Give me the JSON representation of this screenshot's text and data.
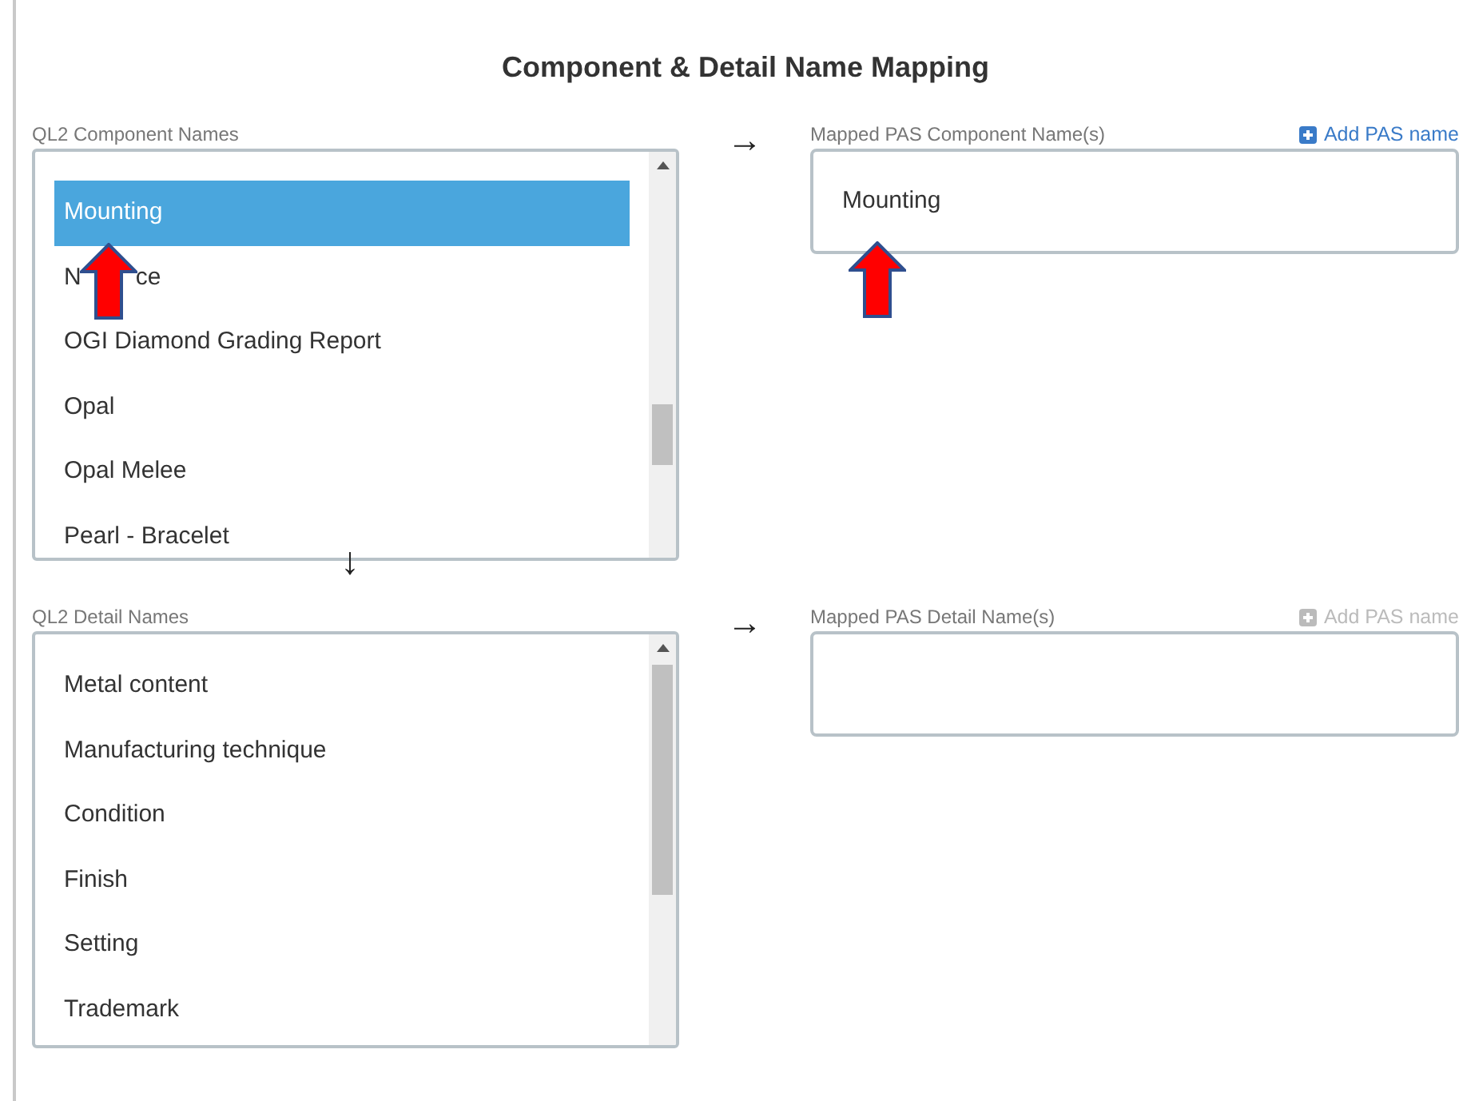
{
  "title": "Component & Detail Name Mapping",
  "sections": [
    {
      "source_label": "QL2 Component Names",
      "down_arrow": "↓",
      "right_arrow": "→",
      "mapped_label": "Mapped PAS Component Name(s)",
      "add_link": {
        "label": "Add PAS name",
        "disabled": false
      },
      "items": [
        {
          "label": "Mounting",
          "selected": true
        },
        {
          "label": "N",
          "label_end": "ce",
          "selected": false
        },
        {
          "label": "OGI Diamond Grading Report",
          "selected": false
        },
        {
          "label": "Opal",
          "selected": false
        },
        {
          "label": "Opal Melee",
          "selected": false
        },
        {
          "label": "Pearl - Bracelet",
          "selected": false
        }
      ],
      "mapped": [
        "Mounting"
      ]
    },
    {
      "source_label": "QL2 Detail Names",
      "right_arrow": "→",
      "mapped_label": "Mapped PAS Detail Name(s)",
      "add_link": {
        "label": "Add PAS name",
        "disabled": true
      },
      "items": [
        {
          "label": "Metal content",
          "selected": false
        },
        {
          "label": "Manufacturing technique",
          "selected": false
        },
        {
          "label": "Condition",
          "selected": false
        },
        {
          "label": "Finish",
          "selected": false
        },
        {
          "label": "Setting",
          "selected": false
        },
        {
          "label": "Trademark",
          "selected": false
        }
      ]
    }
  ]
}
